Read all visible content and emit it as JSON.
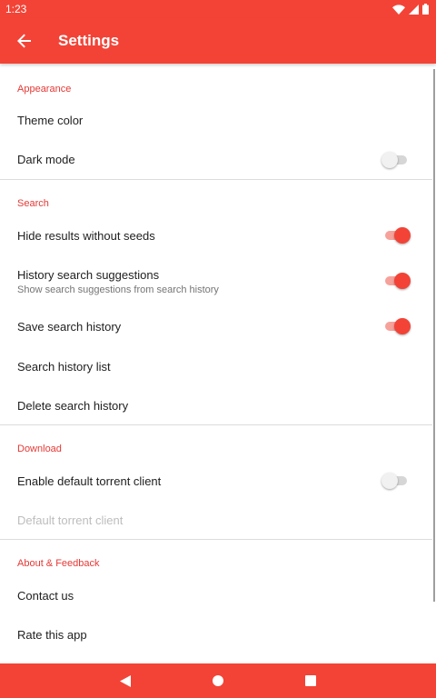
{
  "status_bar": {
    "time": "1:23"
  },
  "app_bar": {
    "title": "Settings"
  },
  "sections": {
    "appearance": {
      "header": "Appearance",
      "theme_color": {
        "title": "Theme color"
      },
      "dark_mode": {
        "title": "Dark mode",
        "enabled": false
      }
    },
    "search": {
      "header": "Search",
      "hide_results_without_seeds": {
        "title": "Hide results without seeds",
        "enabled": true
      },
      "history_search_suggestions": {
        "title": "History search suggestions",
        "summary": "Show search suggestions from search history",
        "enabled": true
      },
      "save_search_history": {
        "title": "Save search history",
        "enabled": true
      },
      "search_history_list": {
        "title": "Search history list"
      },
      "delete_search_history": {
        "title": "Delete search history"
      }
    },
    "download": {
      "header": "Download",
      "enable_default_torrent_client": {
        "title": "Enable default torrent client",
        "enabled": false
      },
      "default_torrent_client": {
        "title": "Default torrent client",
        "disabled": true
      }
    },
    "about": {
      "header": "About & Feedback",
      "contact_us": {
        "title": "Contact us"
      },
      "rate_this_app": {
        "title": "Rate this app"
      }
    }
  },
  "colors": {
    "primary": "#f34336",
    "accent": "#e53935",
    "switch_track_on": "#f7a19b"
  },
  "nav_bar": {
    "icons": [
      "back-triangle-icon",
      "home-circle-icon",
      "recents-square-icon"
    ]
  }
}
